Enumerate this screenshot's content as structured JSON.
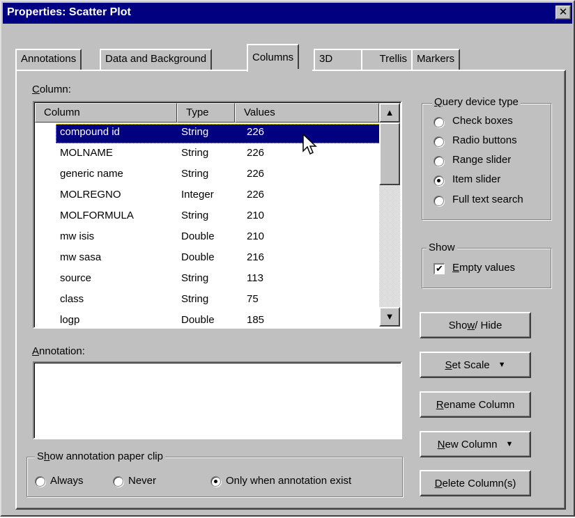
{
  "window": {
    "title": "Properties: Scatter Plot",
    "close_glyph": "✕"
  },
  "tabs": [
    {
      "label": "Annotations",
      "active": false
    },
    {
      "label": "Data and Background",
      "active": false
    },
    {
      "label": "Columns",
      "active": true
    },
    {
      "label": "3D",
      "active": false
    },
    {
      "label": "Trellis",
      "active": false
    },
    {
      "label": "Markers",
      "active": false
    }
  ],
  "columns_list": {
    "label_accel": "C",
    "label_rest": "olumn:",
    "headers": [
      "Column",
      "Type",
      "Values"
    ],
    "rows": [
      {
        "column": "compound id",
        "type": "String",
        "values": "226",
        "selected": true
      },
      {
        "column": "MOLNAME",
        "type": "String",
        "values": "226"
      },
      {
        "column": "generic name",
        "type": "String",
        "values": "226"
      },
      {
        "column": "MOLREGNO",
        "type": "Integer",
        "values": "226"
      },
      {
        "column": "MOLFORMULA",
        "type": "String",
        "values": "210"
      },
      {
        "column": "mw isis",
        "type": "Double",
        "values": "210"
      },
      {
        "column": "mw sasa",
        "type": "Double",
        "values": "216"
      },
      {
        "column": "source",
        "type": "String",
        "values": "113"
      },
      {
        "column": "class",
        "type": "String",
        "values": "75"
      },
      {
        "column": "logp",
        "type": "Double",
        "values": "185"
      }
    ]
  },
  "annotation": {
    "label_accel": "A",
    "label_rest": "nnotation:",
    "value": ""
  },
  "paperclip_group": {
    "title_pre": "S",
    "title_accel": "h",
    "title_post": "ow annotation paper clip",
    "options": [
      {
        "label": "Always",
        "checked": false
      },
      {
        "label": "Never",
        "checked": false
      },
      {
        "label": "Only when annotation exist",
        "checked": true
      }
    ]
  },
  "query_device": {
    "title_accel": "Q",
    "title_rest": "uery device type",
    "options": [
      {
        "label": "Check boxes",
        "checked": false
      },
      {
        "label": "Radio buttons",
        "checked": false
      },
      {
        "label": "Range slider",
        "checked": false
      },
      {
        "label": "Item slider",
        "checked": true
      },
      {
        "label": "Full text search",
        "checked": false
      }
    ]
  },
  "show_group": {
    "title": "Show",
    "empty_values_accel": "E",
    "empty_values_rest": "mpty values",
    "empty_values_checked": true,
    "check_glyph": "✔"
  },
  "buttons": {
    "show_hide_pre": "Sho",
    "show_hide_accel": "w",
    "show_hide_post": " / Hide",
    "set_scale_accel": "S",
    "set_scale_rest": "et Scale",
    "rename_accel": "R",
    "rename_rest": "ename Column",
    "new_column_accel": "N",
    "new_column_rest": "ew Column",
    "delete_accel": "D",
    "delete_rest": "elete Column(s)",
    "dropdown_glyph": "▼"
  },
  "scrollbar": {
    "up_glyph": "▲",
    "down_glyph": "▼"
  }
}
